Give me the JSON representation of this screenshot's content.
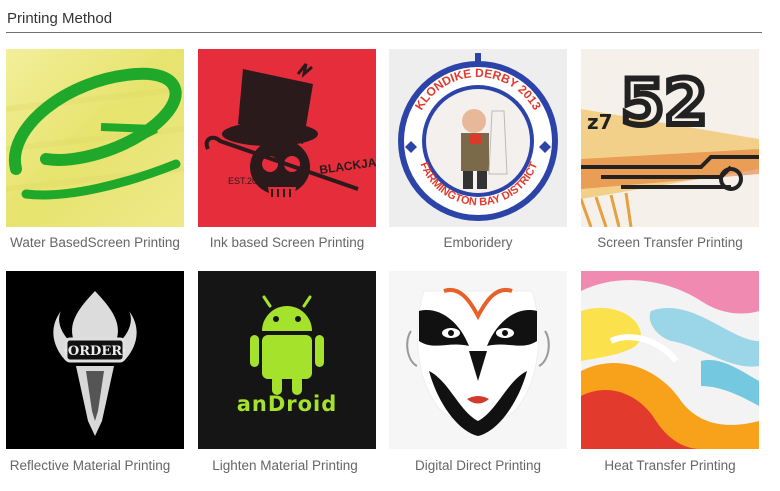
{
  "header": {
    "title": "Printing Method"
  },
  "items": [
    {
      "caption": "Water BasedScreen Printing",
      "image": "green-swoosh-on-yellow-fabric"
    },
    {
      "caption": "Ink based Screen Printing",
      "image": "skull-top-hat-on-red-shirt"
    },
    {
      "caption": "Emboridery",
      "image": "embroidered-badge",
      "badge_text": [
        "KLONDIKE DERBY 2013",
        "FARMINGTON BAY DISTRICT"
      ]
    },
    {
      "caption": "Screen Transfer Printing",
      "image": "number-52-graphic"
    },
    {
      "caption": "Reflective Material Printing",
      "image": "reflective-flame-emblem"
    },
    {
      "caption": "Lighten Material Printing",
      "image": "glowing-android-logo"
    },
    {
      "caption": "Digital Direct Printing",
      "image": "opera-mask-face"
    },
    {
      "caption": "Heat Transfer Printing",
      "image": "colorful-wave-fabric"
    }
  ],
  "colors": {
    "header_rule": "#6f6f6f",
    "caption": "#666666",
    "android_green": "#a4e22c"
  }
}
